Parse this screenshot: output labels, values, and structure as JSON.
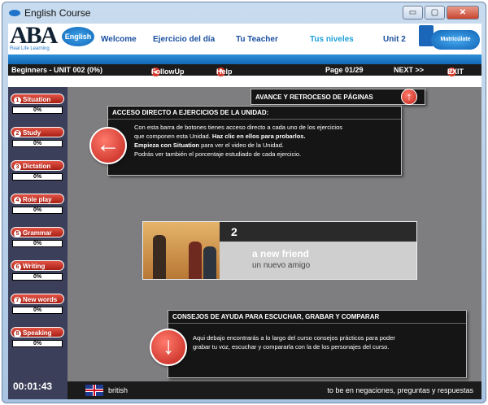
{
  "window": {
    "title": "English Course",
    "minimize": "▭",
    "maximize": "▢",
    "close": "✕"
  },
  "nav": {
    "logo_text": "ABA",
    "logo_tagline": "Real Life Learning",
    "badge": "English",
    "links": [
      "Welcome",
      "Ejercicio del día",
      "Tu Teacher",
      "Tus niveles",
      "Unit 2"
    ],
    "active_link": "Tus niveles",
    "enroll": "Matricúlate"
  },
  "statusbar": {
    "course": "Beginners - UNIT 002 (0%)",
    "followup": "FollowUp",
    "help": "Help",
    "page": "Page 01/29",
    "next": "NEXT >>",
    "exit": "EXIT"
  },
  "sidebar": {
    "items": [
      {
        "num": "1",
        "label": "Situation",
        "pct": "0%"
      },
      {
        "num": "2",
        "label": "Study",
        "pct": "0%"
      },
      {
        "num": "3",
        "label": "Dictation",
        "pct": "0%"
      },
      {
        "num": "4",
        "label": "Role play",
        "pct": "0%"
      },
      {
        "num": "5",
        "label": "Grammar",
        "pct": "0%"
      },
      {
        "num": "6",
        "label": "Writing",
        "pct": "0%"
      },
      {
        "num": "7",
        "label": "New words",
        "pct": "0%"
      },
      {
        "num": "8",
        "label": "Speaking",
        "pct": "0%"
      }
    ],
    "timer": "00:01:43"
  },
  "tips": {
    "paging": {
      "title": "AVANCE Y RETROCESO DE PÁGINAS"
    },
    "direct": {
      "title": "ACCESO DIRECTO A EJERCICIOS DE LA UNIDAD:",
      "line1": "Con esta barra de botones tienes acceso directo a cada uno de los ejercicios",
      "line2a": "que componen esta Unidad. ",
      "line2b": "Haz clic en ellos para probarlos.",
      "line3a": "Empieza con Situation",
      "line3b": " para ver el video de la Unidad.",
      "line4": "Podrás ver también el porcentaje estudiado de cada ejercicio."
    },
    "advice": {
      "title": "CONSEJOS DE AYUDA PARA ESCUCHAR, GRABAR Y COMPARAR",
      "line1": "Aqui debajo encontrarás a lo largo del curso consejos prácticos para poder",
      "line2": "grabar tu voz, escuchar y compararla con la de los personajes del curso."
    }
  },
  "card": {
    "number": "2",
    "title": "a new friend",
    "subtitle": "un nuevo amigo"
  },
  "bottom": {
    "accent": "british",
    "topic": "to be en negaciones, preguntas y respuestas"
  }
}
